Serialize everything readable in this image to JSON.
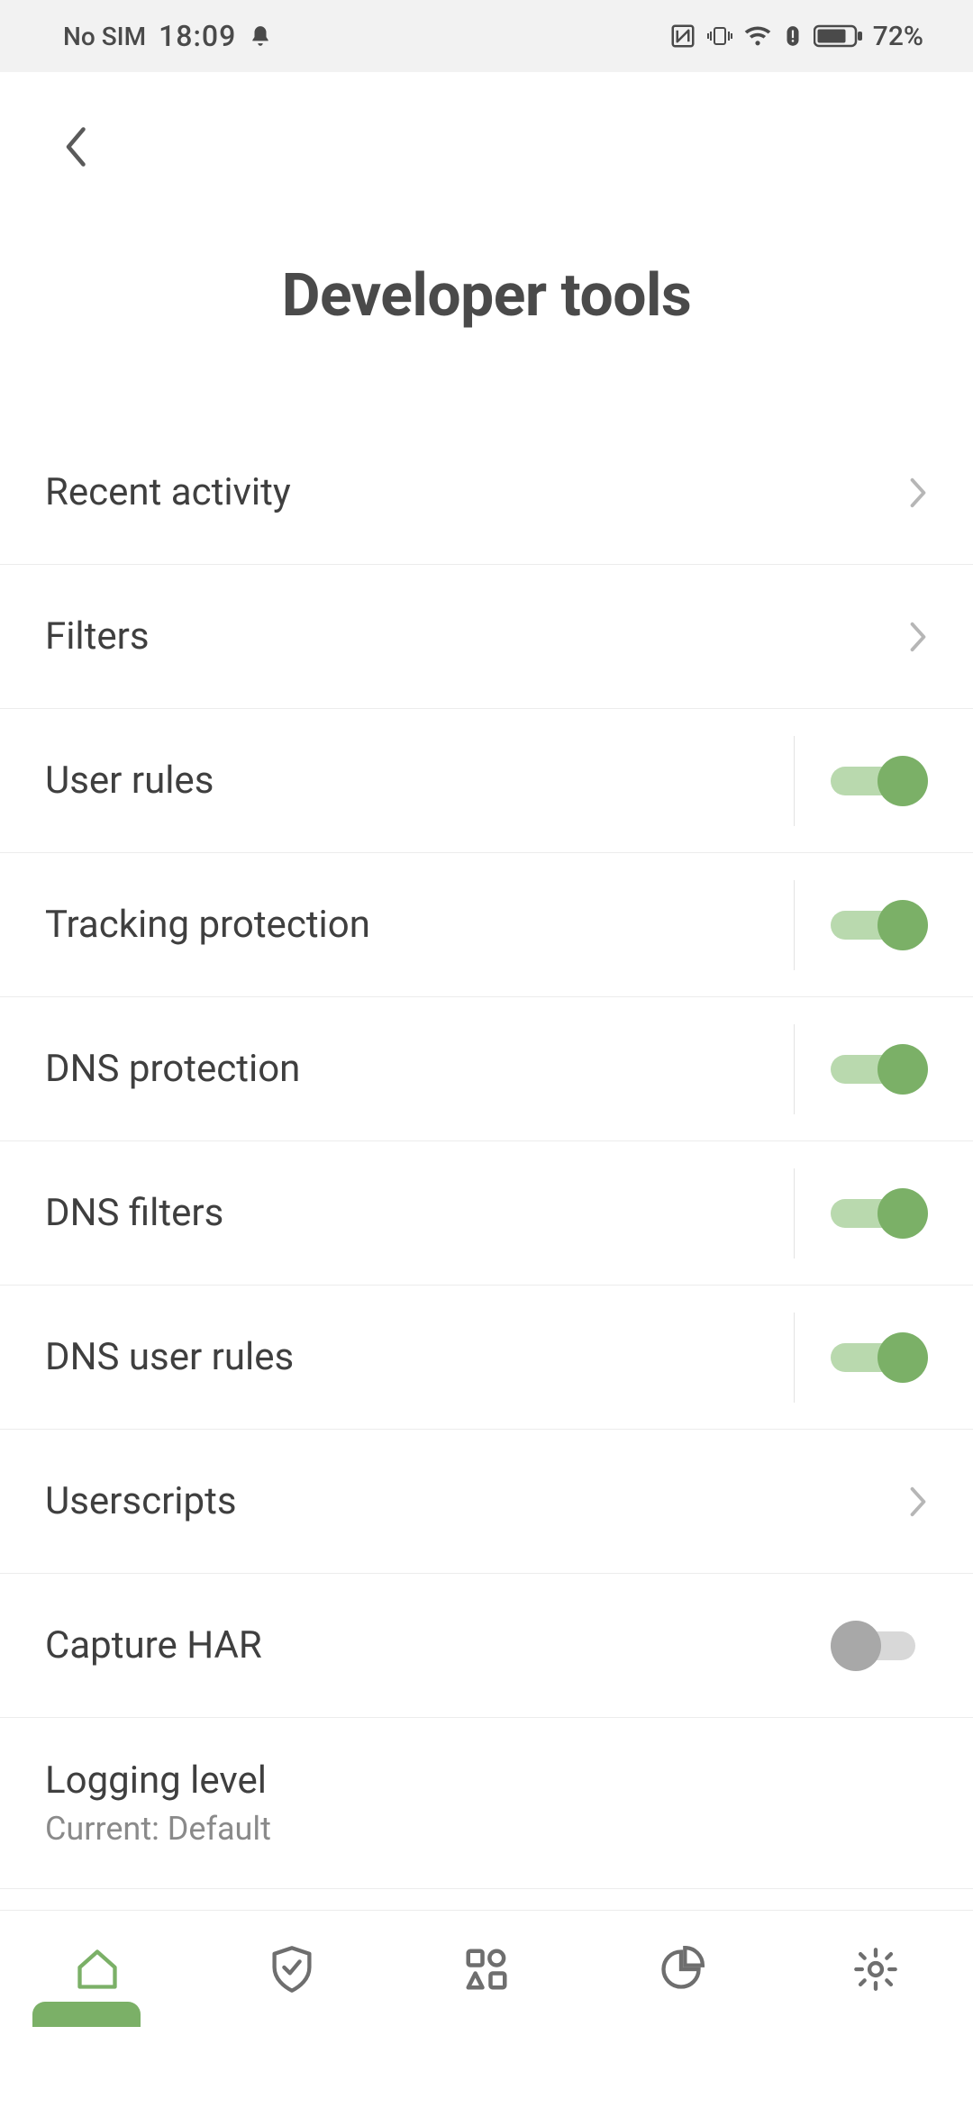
{
  "status": {
    "no_sim": "No SIM",
    "time": "18:09",
    "battery": "72%"
  },
  "page": {
    "title": "Developer tools"
  },
  "rows": {
    "recent_activity": "Recent activity",
    "filters": "Filters",
    "user_rules": "User rules",
    "tracking_protection": "Tracking protection",
    "dns_protection": "DNS protection",
    "dns_filters": "DNS filters",
    "dns_user_rules": "DNS user rules",
    "userscripts": "Userscripts",
    "capture_har": "Capture HAR",
    "logging_level": "Logging level",
    "logging_level_sub": "Current: Default"
  },
  "toggles": {
    "user_rules": true,
    "tracking_protection": true,
    "dns_protection": true,
    "dns_filters": true,
    "dns_user_rules": true,
    "capture_har": false
  },
  "colors": {
    "accent": "#7bb067",
    "accent_light": "#b9d9ae",
    "text_primary": "#3f3f3f",
    "text_secondary": "#8a8a8a",
    "divider": "#ececec",
    "status_bg": "#f2f2f2"
  }
}
